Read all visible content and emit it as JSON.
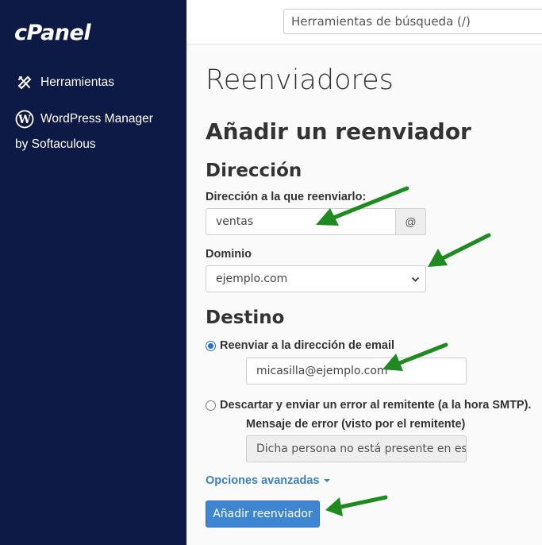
{
  "sidebar": {
    "logo": "cPanel",
    "items": [
      {
        "label": "Herramientas",
        "icon": "tools-icon"
      },
      {
        "label": "WordPress Manager",
        "sublabel": "by Softaculous",
        "icon": "wordpress-icon"
      }
    ]
  },
  "header": {
    "search": {
      "value": "Herramientas de búsqueda (/)"
    }
  },
  "main": {
    "page_title": "Reenviadores",
    "section_title": "Añadir un reenviador",
    "address": {
      "heading": "Dirección",
      "label": "Dirección a la que reenviarlo:",
      "value": "ventas",
      "addon": "@"
    },
    "domain": {
      "label": "Dominio",
      "value": "ejemplo.com"
    },
    "destination": {
      "heading": "Destino",
      "option_forward": "Reenviar a la dirección de email",
      "forward_value": "micasilla@ejemplo.com",
      "option_discard": "Descartar y enviar un error al remitente (a la hora SMTP).",
      "error_label": "Mensaje de error (visto por el remitente)",
      "error_value": "Dicha persona no está presente en esta"
    },
    "advanced_link": "Opciones avanzadas",
    "submit_label": "Añadir reenviador"
  },
  "colors": {
    "sidebar_bg": "#0d1a45",
    "accent": "#3f86d2",
    "link": "#3b7fc4",
    "annotation_arrow": "#1f8a1f"
  }
}
